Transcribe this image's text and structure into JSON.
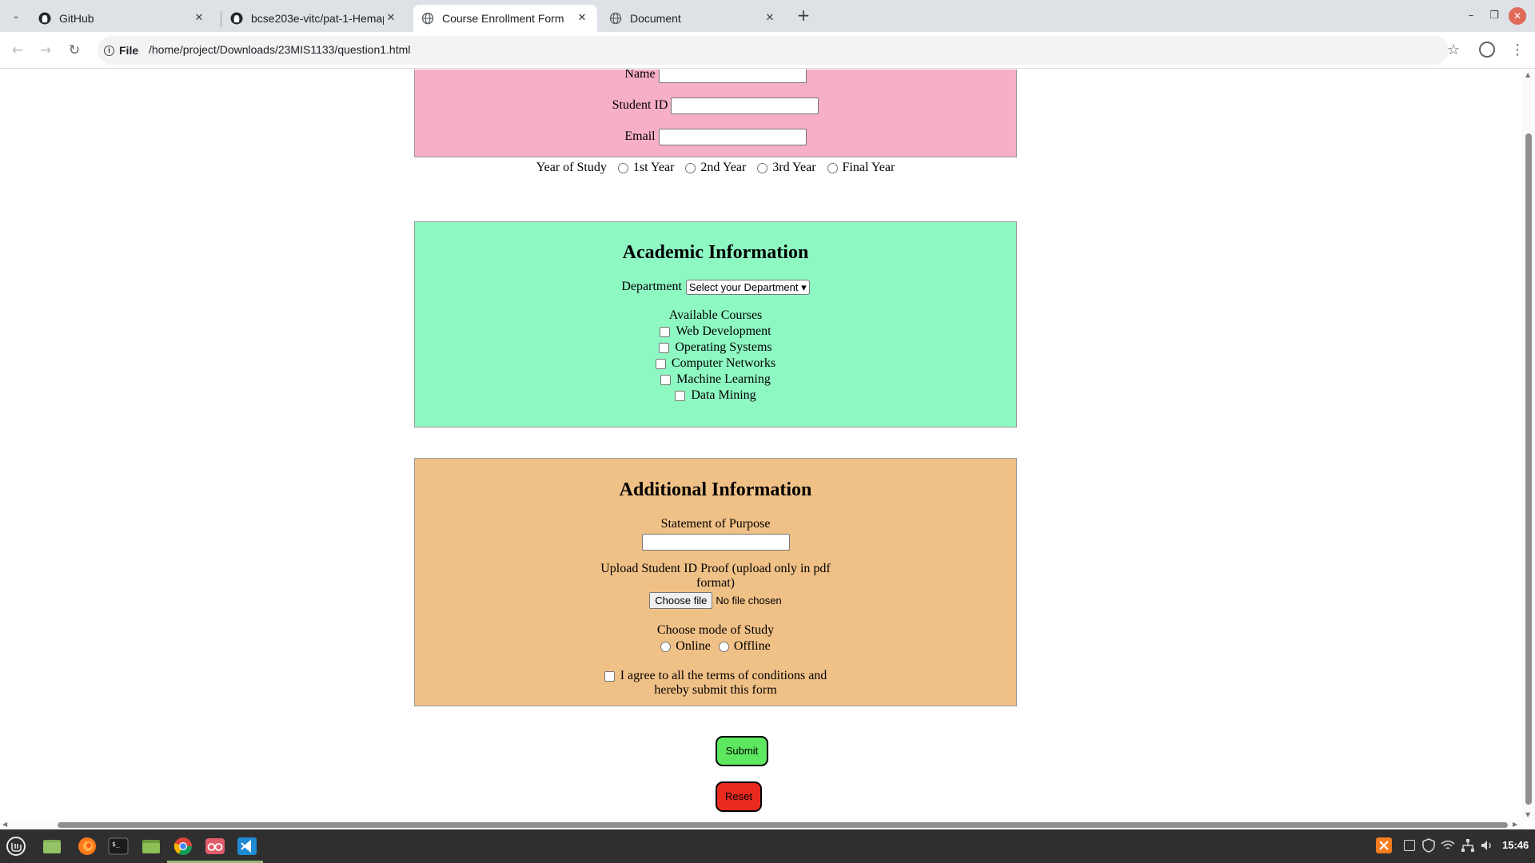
{
  "browser": {
    "tabs": [
      {
        "title": "GitHub",
        "icon": "github-icon",
        "active": false
      },
      {
        "title": "bcse203e-vitc/pat-1-Hemap",
        "icon": "github-icon",
        "active": false
      },
      {
        "title": "Course Enrollment Form",
        "icon": "globe-icon",
        "active": true
      },
      {
        "title": "Document",
        "icon": "globe-icon",
        "active": false
      }
    ],
    "new_tab": "+",
    "tab_close": "✕",
    "tab_list": "⌄",
    "window": {
      "minimize": "–",
      "restore": "❐",
      "close": "✕"
    },
    "nav": {
      "back": "←",
      "forward": "→",
      "reload": "↻"
    },
    "address": {
      "scheme_chip": "File",
      "info": "i",
      "url": "/home/project/Downloads/23MIS1133/question1.html"
    },
    "star": "☆",
    "menu": "⋮"
  },
  "form": {
    "personal": {
      "name_label": "Name",
      "student_id_label": "Student ID",
      "email_label": "Email",
      "year_label": "Year of Study",
      "year_options": [
        "1st Year",
        "2nd Year",
        "3rd Year",
        "Final Year"
      ]
    },
    "academic": {
      "heading": "Academic Information",
      "department_label": "Department",
      "department_selected": "Select your Department ▾",
      "courses_label": "Available Courses",
      "courses": [
        "Web Development",
        "Operating Systems",
        "Computer Networks",
        "Machine Learning",
        "Data Mining"
      ]
    },
    "additional": {
      "heading": "Additional Information",
      "sop_label": "Statement of Purpose",
      "upload_label_line1": "Upload Student ID Proof (upload only in pdf",
      "upload_label_line2": "format)",
      "file_button": "Choose file",
      "file_status": "No file chosen",
      "mode_label": "Choose mode of Study",
      "mode_options": [
        "Online",
        "Offline"
      ],
      "terms_line1": "I agree to all the terms of conditions and",
      "terms_line2": "hereby submit this form"
    },
    "submit_label": "Submit",
    "reset_label": "Reset"
  },
  "taskbar": {
    "apps": [
      "mint-menu-icon",
      "desktop-folder-icon",
      "firefox-icon",
      "terminal-icon",
      "files-icon",
      "chrome-icon",
      "glasses-app-icon",
      "vscode-icon"
    ],
    "clock": "15:46"
  },
  "colors": {
    "personal_bg": "#f7aec8",
    "academic_bg": "#8ef8c3",
    "additional_bg": "#f0c187",
    "submit_bg": "#5ee860",
    "reset_bg": "#eb2a1f"
  }
}
